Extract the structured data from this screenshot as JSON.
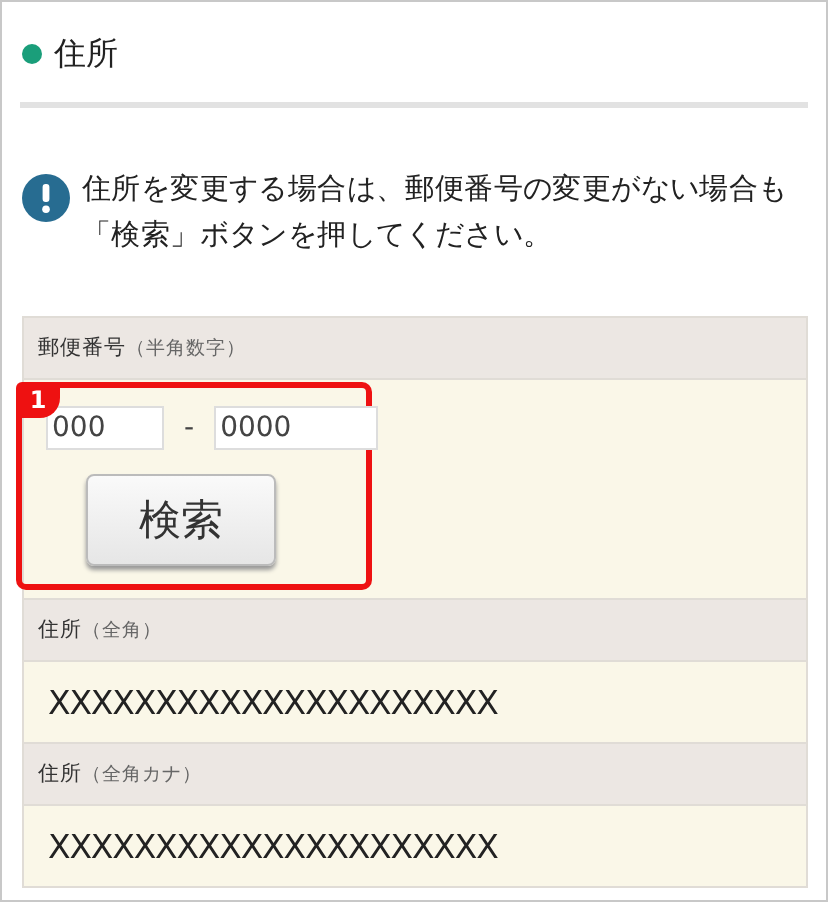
{
  "heading": {
    "title": "住所",
    "color": "#1a9e7a"
  },
  "notice": {
    "text": "住所を変更する場合は、郵便番号の変更がない場合も「検索」ボタンを押してください。"
  },
  "postal": {
    "label": "郵便番号",
    "hint": "（半角数字）",
    "first": "000",
    "separator": "-",
    "second": "0000",
    "button": "検索",
    "callout": "1"
  },
  "fields": [
    {
      "label": "住所",
      "hint": "（全角）",
      "value": "XXXXXXXXXXXXXXXXXXXXX"
    },
    {
      "label": "住所",
      "hint": "（全角カナ）",
      "value": "XXXXXXXXXXXXXXXXXXXXX"
    }
  ]
}
